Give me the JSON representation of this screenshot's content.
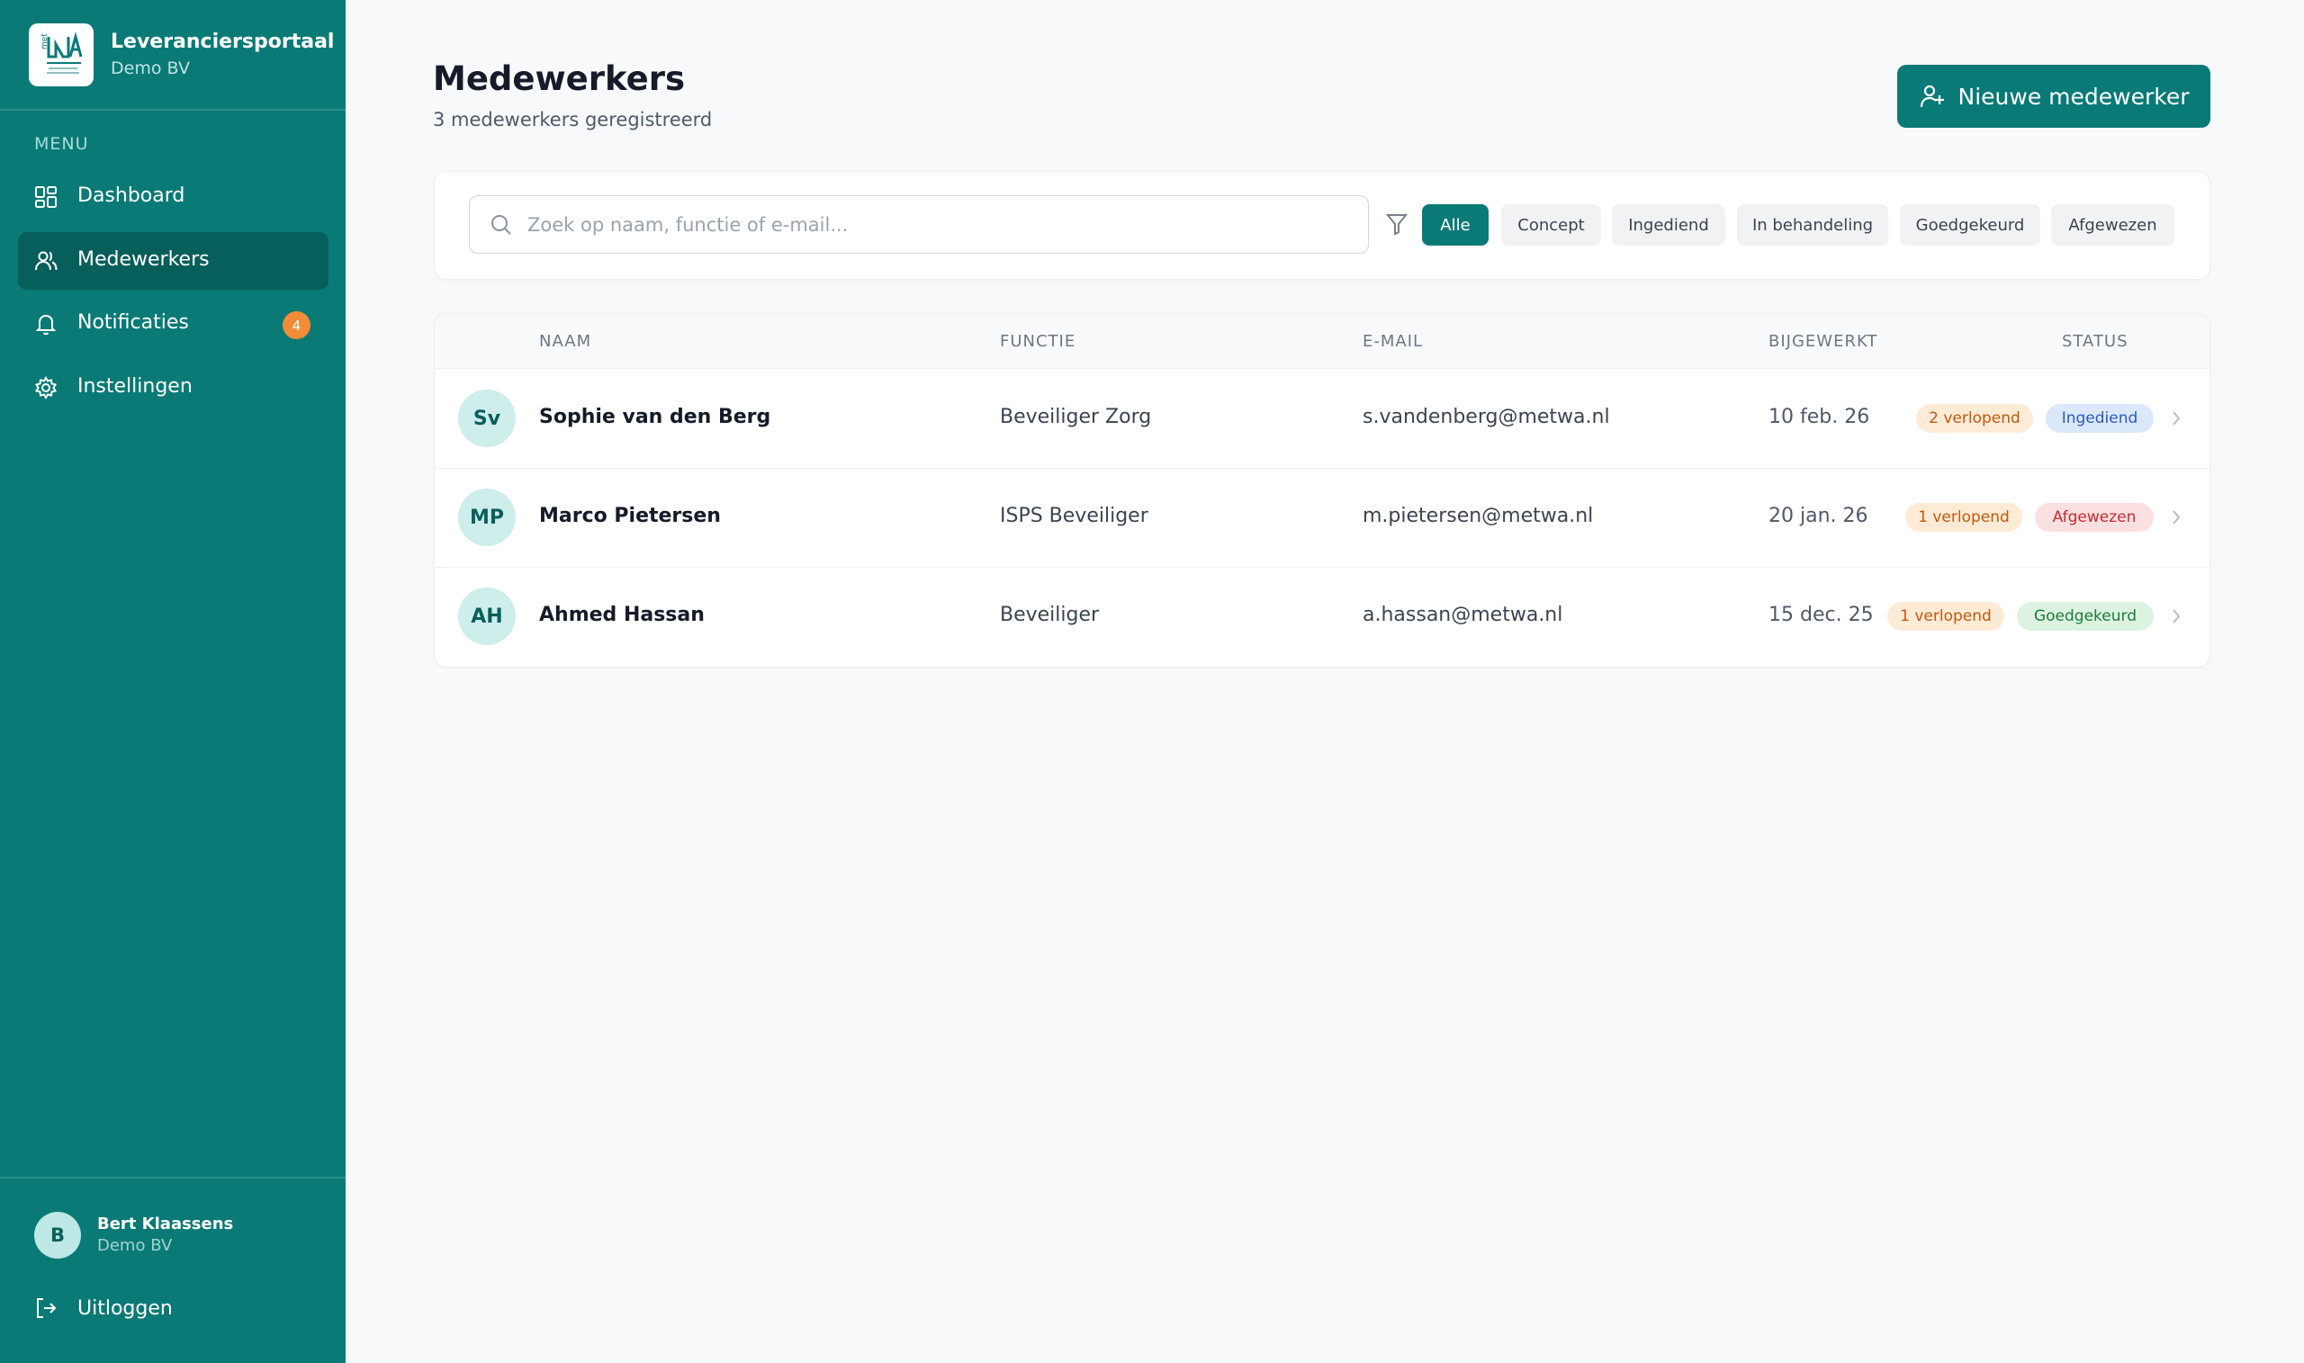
{
  "brand": {
    "title": "Leveranciersportaal",
    "subtitle": "Demo BV"
  },
  "sidebar": {
    "menu_label": "MENU",
    "items": [
      {
        "label": "Dashboard",
        "icon": "dashboard-icon"
      },
      {
        "label": "Medewerkers",
        "icon": "users-icon",
        "active": true
      },
      {
        "label": "Notificaties",
        "icon": "bell-icon",
        "badge": "4"
      },
      {
        "label": "Instellingen",
        "icon": "gear-icon"
      }
    ],
    "user": {
      "initial": "B",
      "name": "Bert Klaassens",
      "org": "Demo BV"
    },
    "logout": "Uitloggen"
  },
  "header": {
    "title": "Medewerkers",
    "subtitle": "3 medewerkers geregistreerd",
    "new_button": "Nieuwe medewerker"
  },
  "filters": {
    "search_placeholder": "Zoek op naam, functie of e-mail...",
    "chips": [
      "Alle",
      "Concept",
      "Ingediend",
      "In behandeling",
      "Goedgekeurd",
      "Afgewezen"
    ],
    "active_chip": "Alle"
  },
  "table": {
    "columns": [
      "NAAM",
      "FUNCTIE",
      "E-MAIL",
      "BIJGEWERKT",
      "STATUS"
    ],
    "rows": [
      {
        "initials": "Sv",
        "name": "Sophie van den Berg",
        "function": "Beveiliger Zorg",
        "email": "s.vandenberg@metwa.nl",
        "updated": "10 feb. 26",
        "expiring": "2 verlopend",
        "status": "Ingediend"
      },
      {
        "initials": "MP",
        "name": "Marco Pietersen",
        "function": "ISPS Beveiliger",
        "email": "m.pietersen@metwa.nl",
        "updated": "20 jan. 26",
        "expiring": "1 verlopend",
        "status": "Afgewezen"
      },
      {
        "initials": "AH",
        "name": "Ahmed Hassan",
        "function": "Beveiliger",
        "email": "a.hassan@metwa.nl",
        "updated": "15 dec. 25",
        "expiring": "1 verlopend",
        "status": "Goedgekeurd"
      }
    ]
  },
  "colors": {
    "primary": "#0a7a76",
    "badge": "#f28c38"
  }
}
